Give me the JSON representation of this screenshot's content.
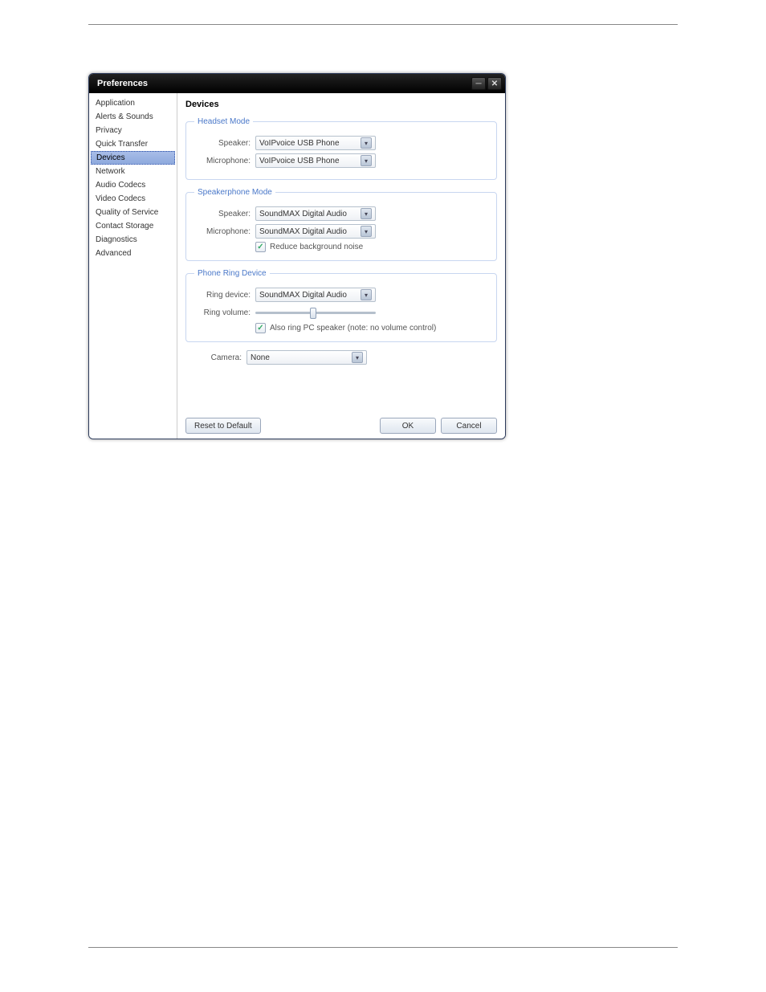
{
  "window": {
    "title": "Preferences"
  },
  "sidebar": {
    "items": [
      {
        "label": "Application"
      },
      {
        "label": "Alerts & Sounds"
      },
      {
        "label": "Privacy"
      },
      {
        "label": "Quick Transfer"
      },
      {
        "label": "Devices",
        "selected": true
      },
      {
        "label": "Network"
      },
      {
        "label": "Audio Codecs"
      },
      {
        "label": "Video Codecs"
      },
      {
        "label": "Quality of Service"
      },
      {
        "label": "Contact Storage"
      },
      {
        "label": "Diagnostics"
      },
      {
        "label": "Advanced"
      }
    ]
  },
  "main": {
    "header": "Devices",
    "headset": {
      "legend": "Headset Mode",
      "speaker_label": "Speaker:",
      "speaker_value": "VoIPvoice USB Phone",
      "mic_label": "Microphone:",
      "mic_value": "VoIPvoice USB Phone"
    },
    "speakerphone": {
      "legend": "Speakerphone Mode",
      "speaker_label": "Speaker:",
      "speaker_value": "SoundMAX Digital Audio",
      "mic_label": "Microphone:",
      "mic_value": "SoundMAX Digital Audio",
      "noise_label": "Reduce background noise"
    },
    "ring": {
      "legend": "Phone Ring Device",
      "device_label": "Ring device:",
      "device_value": "SoundMAX Digital Audio",
      "volume_label": "Ring volume:",
      "pcspeaker_label": "Also ring PC speaker (note: no volume control)"
    },
    "camera": {
      "label": "Camera:",
      "value": "None"
    },
    "buttons": {
      "reset": "Reset to Default",
      "ok": "OK",
      "cancel": "Cancel"
    }
  }
}
